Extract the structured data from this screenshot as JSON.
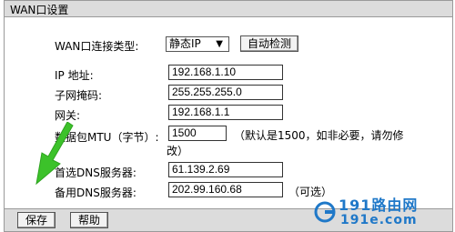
{
  "panel": {
    "title": "WAN口设置"
  },
  "wan": {
    "type_label": "WAN口连接类型:",
    "type_value": "静态IP",
    "detect_button": "自动检测"
  },
  "fields": {
    "ip_label": "IP 地址:",
    "ip_value": "192.168.1.10",
    "mask_label": "子网掩码:",
    "mask_value": "255.255.255.0",
    "gateway_label": "网关:",
    "gateway_value": "192.168.1.1",
    "mtu_label": "数据包MTU（字节）:",
    "mtu_value": "1500",
    "mtu_note_line1": "（默认是1500，如非必要，请勿修",
    "mtu_note_line2": "改）",
    "dns1_label": "首选DNS服务器:",
    "dns1_value": "61.139.2.69",
    "dns2_label": "备用DNS服务器:",
    "dns2_value": "202.99.160.68",
    "dns2_note": "（可选）"
  },
  "footer": {
    "save_button": "保存",
    "help_button": "帮助"
  },
  "watermark": {
    "line1": "191路由网",
    "line2": "191e.com"
  },
  "colors": {
    "arrow": "#3cc22a",
    "watermark": "#1f78c8",
    "title_bar": "#dcdcdc"
  }
}
